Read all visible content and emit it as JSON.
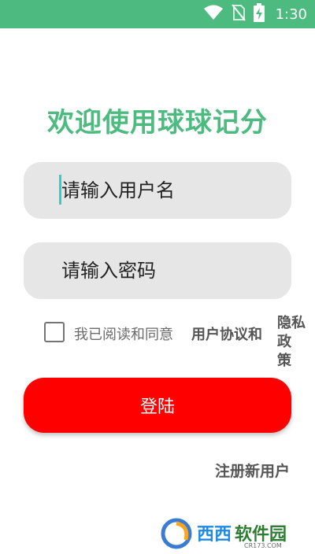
{
  "status_bar": {
    "time": "1:30",
    "icons": [
      "wifi-icon",
      "no-sim-icon",
      "battery-charging-icon"
    ],
    "color": "#4dbb7f"
  },
  "title": "欢迎使用球球记分",
  "username": {
    "placeholder": "请输入用户名",
    "value": ""
  },
  "password": {
    "placeholder": "请输入密码",
    "value": ""
  },
  "agreement": {
    "checked": false,
    "prefix": "我已阅读和同意",
    "user_agreement_link": "用户协议和",
    "privacy_line1": "隐私政",
    "privacy_line2": "策"
  },
  "login_button": {
    "label": "登陆",
    "color": "#ff0000"
  },
  "register_link": "注册新用户",
  "watermark": {
    "text": "西西软件园",
    "sub": "CR173.COM"
  }
}
